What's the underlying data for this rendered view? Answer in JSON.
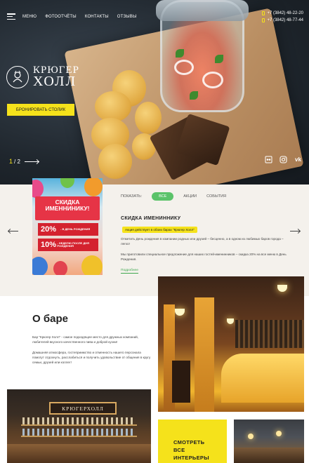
{
  "nav": {
    "links": [
      "МЕНЮ",
      "ФОТООТЧЁТЫ",
      "КОНТАКТЫ",
      "ОТЗЫВЫ"
    ],
    "phones": [
      "+7 (3842) 48-22-20",
      "+7 (3842) 48-77-44"
    ]
  },
  "hero": {
    "logo_line1": "КРЮГЕР",
    "logo_line2": "ХОЛЛ",
    "book_button": "БРОНИРОВАТЬ СТОЛИК",
    "slide_current": "1",
    "slide_total": "/ 2"
  },
  "promo": {
    "filter_label": "ПОКАЗАТЬ:",
    "filters": [
      "ВСЕ",
      "АКЦИИ",
      "СОБЫТИЯ"
    ],
    "card_banner": "СКИДКА ИМЕННИНИКУ!",
    "card_disc1_big": "20%",
    "card_disc1_small": "- В ДЕНЬ РОЖДЕНИЯ",
    "card_disc2_big": "10%",
    "card_disc2_small": "- НЕДЕЛЮ ПОСЛЕ ДНЯ РОЖДЕНИЯ",
    "title": "СКИДКА ИМЕНИННИКУ",
    "tag": "Акция действует в обоих барах \"Крюгер Холл\"",
    "p1": "Отметить День рождения в компании родных или друзей – бесценно, а в одном из любимых баров города – легко!",
    "p2": "Мы приготовили специальное предложение для наших гостей-именинников – скидка 20% на все меню в День Рождения.",
    "more": "Подробнее"
  },
  "about": {
    "title": "О баре",
    "p1": "Бар \"Крюгер Холл\" - самое подходящее место для дружных компаний, любителей вкусного качественного пива и доброй кухни!",
    "p2": "Домашняя атмосфера, гостеприимство и отменность нашего персонала помогут отдохнуть, расслабиться и получить удовольствие от общения в кругу семьи, друзей или коллег!",
    "sign": "КРЮГЕРХОЛЛ",
    "cta_line1": "СМОТРЕТЬ",
    "cta_line2": "ВСЕ",
    "cta_line3": "ИНТЕРЬЕРЫ"
  },
  "socials": [
    "tripadvisor-icon",
    "instagram-icon",
    "vk-icon"
  ],
  "colors": {
    "accent": "#f5e21b",
    "green": "#5bc36a",
    "promo_bg": "#f4f1ec"
  }
}
